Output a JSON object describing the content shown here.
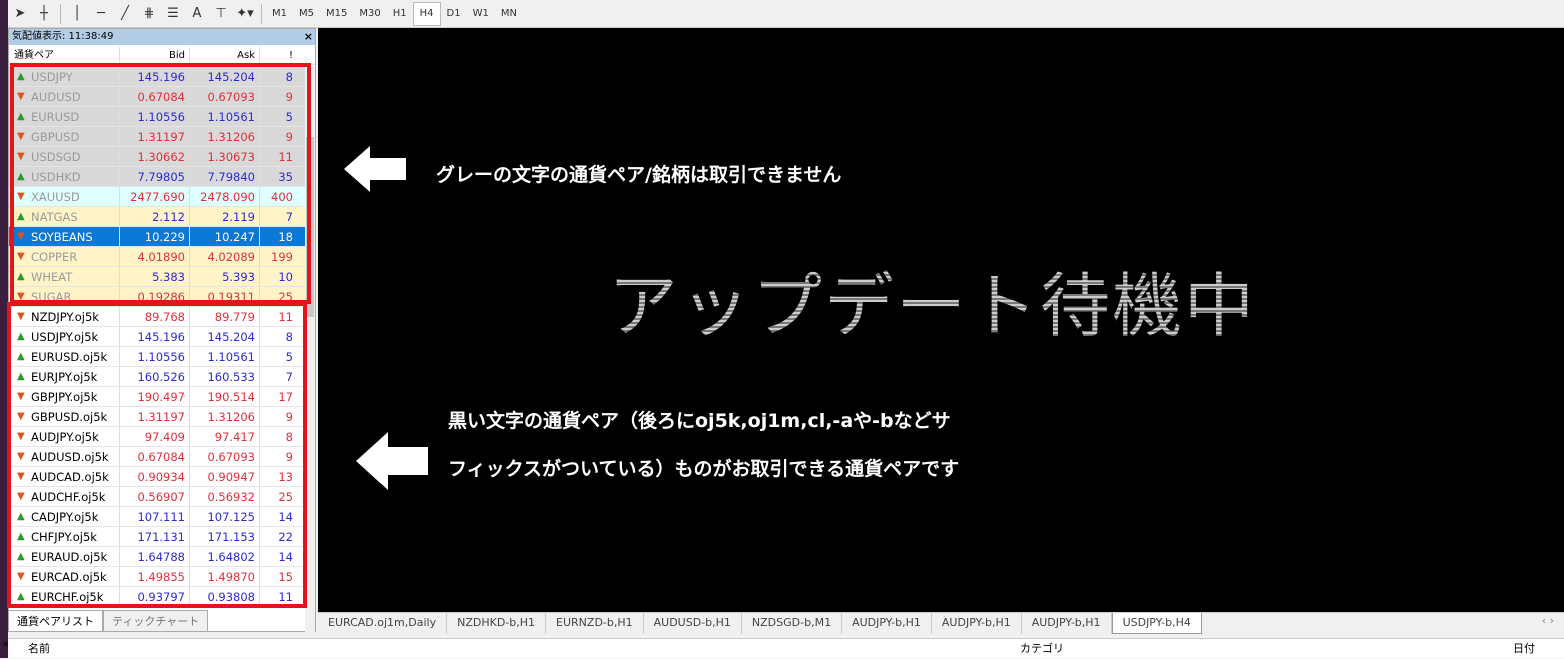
{
  "toolbar": {
    "tools": [
      "cursor",
      "crosshair",
      "vertical-line",
      "horizontal-line",
      "trend-line",
      "fibonacci",
      "channel",
      "text",
      "text-label",
      "shapes"
    ],
    "text_tool": "A",
    "timeframes": [
      "M1",
      "M5",
      "M15",
      "M30",
      "H1",
      "H4",
      "D1",
      "W1",
      "MN"
    ],
    "active_timeframe": "H4"
  },
  "market_watch": {
    "title": "気配値表示: 11:38:49",
    "columns": [
      "通貨ペア",
      "Bid",
      "Ask",
      "!"
    ],
    "rows": [
      {
        "symbol": "USDJPY",
        "bid": "145.196",
        "ask": "145.204",
        "spread": "8",
        "dir": "up",
        "bg": "g"
      },
      {
        "symbol": "AUDUSD",
        "bid": "0.67084",
        "ask": "0.67093",
        "spread": "9",
        "dir": "dn",
        "bg": "g"
      },
      {
        "symbol": "EURUSD",
        "bid": "1.10556",
        "ask": "1.10561",
        "spread": "5",
        "dir": "up",
        "bg": "g"
      },
      {
        "symbol": "GBPUSD",
        "bid": "1.31197",
        "ask": "1.31206",
        "spread": "9",
        "dir": "dn",
        "bg": "g"
      },
      {
        "symbol": "USDSGD",
        "bid": "1.30662",
        "ask": "1.30673",
        "spread": "11",
        "dir": "dn",
        "bg": "g"
      },
      {
        "symbol": "USDHKD",
        "bid": "7.79805",
        "ask": "7.79840",
        "spread": "35",
        "dir": "up",
        "bg": "g"
      },
      {
        "symbol": "XAUUSD",
        "bid": "2477.690",
        "ask": "2478.090",
        "spread": "400",
        "dir": "dn",
        "bg": "cy"
      },
      {
        "symbol": "NATGAS",
        "bid": "2.112",
        "ask": "2.119",
        "spread": "7",
        "dir": "up",
        "bg": "y"
      },
      {
        "symbol": "SOYBEANS",
        "bid": "10.229",
        "ask": "10.247",
        "spread": "18",
        "dir": "dn",
        "bg": "sel"
      },
      {
        "symbol": "COPPER",
        "bid": "4.01890",
        "ask": "4.02089",
        "spread": "199",
        "dir": "dn",
        "bg": "y"
      },
      {
        "symbol": "WHEAT",
        "bid": "5.383",
        "ask": "5.393",
        "spread": "10",
        "dir": "up",
        "bg": "y"
      },
      {
        "symbol": "SUGAR",
        "bid": "0.19286",
        "ask": "0.19311",
        "spread": "25",
        "dir": "dn",
        "bg": "y"
      },
      {
        "symbol": "NZDJPY.oj5k",
        "bid": "89.768",
        "ask": "89.779",
        "spread": "11",
        "dir": "dn",
        "bg": ""
      },
      {
        "symbol": "USDJPY.oj5k",
        "bid": "145.196",
        "ask": "145.204",
        "spread": "8",
        "dir": "up",
        "bg": ""
      },
      {
        "symbol": "EURUSD.oj5k",
        "bid": "1.10556",
        "ask": "1.10561",
        "spread": "5",
        "dir": "up",
        "bg": ""
      },
      {
        "symbol": "EURJPY.oj5k",
        "bid": "160.526",
        "ask": "160.533",
        "spread": "7",
        "dir": "up",
        "bg": ""
      },
      {
        "symbol": "GBPJPY.oj5k",
        "bid": "190.497",
        "ask": "190.514",
        "spread": "17",
        "dir": "dn",
        "bg": ""
      },
      {
        "symbol": "GBPUSD.oj5k",
        "bid": "1.31197",
        "ask": "1.31206",
        "spread": "9",
        "dir": "dn",
        "bg": ""
      },
      {
        "symbol": "AUDJPY.oj5k",
        "bid": "97.409",
        "ask": "97.417",
        "spread": "8",
        "dir": "dn",
        "bg": ""
      },
      {
        "symbol": "AUDUSD.oj5k",
        "bid": "0.67084",
        "ask": "0.67093",
        "spread": "9",
        "dir": "dn",
        "bg": ""
      },
      {
        "symbol": "AUDCAD.oj5k",
        "bid": "0.90934",
        "ask": "0.90947",
        "spread": "13",
        "dir": "dn",
        "bg": ""
      },
      {
        "symbol": "AUDCHF.oj5k",
        "bid": "0.56907",
        "ask": "0.56932",
        "spread": "25",
        "dir": "dn",
        "bg": ""
      },
      {
        "symbol": "CADJPY.oj5k",
        "bid": "107.111",
        "ask": "107.125",
        "spread": "14",
        "dir": "up",
        "bg": ""
      },
      {
        "symbol": "CHFJPY.oj5k",
        "bid": "171.131",
        "ask": "171.153",
        "spread": "22",
        "dir": "up",
        "bg": ""
      },
      {
        "symbol": "EURAUD.oj5k",
        "bid": "1.64788",
        "ask": "1.64802",
        "spread": "14",
        "dir": "up",
        "bg": ""
      },
      {
        "symbol": "EURCAD.oj5k",
        "bid": "1.49855",
        "ask": "1.49870",
        "spread": "15",
        "dir": "dn",
        "bg": ""
      },
      {
        "symbol": "EURCHF.oj5k",
        "bid": "0.93797",
        "ask": "0.93808",
        "spread": "11",
        "dir": "up",
        "bg": ""
      }
    ],
    "tabs": [
      "通貨ペアリスト",
      "ティックチャート"
    ],
    "active_tab": "通貨ペアリスト"
  },
  "chart": {
    "status": "アップデート待機中",
    "note1": "グレーの文字の通貨ペア/銘柄は取引できません",
    "note2_line1": "黒い文字の通貨ペア（後ろにoj5k,oj1m,cl,-aや-bなどサ",
    "note2_line2": "フィックスがついている）ものがお取引できる通貨ペアです"
  },
  "chart_tabs": [
    "EURCAD.oj1m,Daily",
    "NZDHKD-b,H1",
    "EURNZD-b,H1",
    "AUDUSD-b,H1",
    "NZDSGD-b,M1",
    "AUDJPY-b,H1",
    "AUDJPY-b,H1",
    "AUDJPY-b,H1",
    "USDJPY-b,H4"
  ],
  "active_chart_tab": "USDJPY-b,H4",
  "bottom": {
    "col_name": "名前",
    "col_category": "カテゴリ",
    "col_date": "日付"
  },
  "colors": {
    "annotation_box": "#e3141c",
    "selected_row": "#0a78d7",
    "up": "#2b2bd0",
    "down": "#e0303a"
  }
}
